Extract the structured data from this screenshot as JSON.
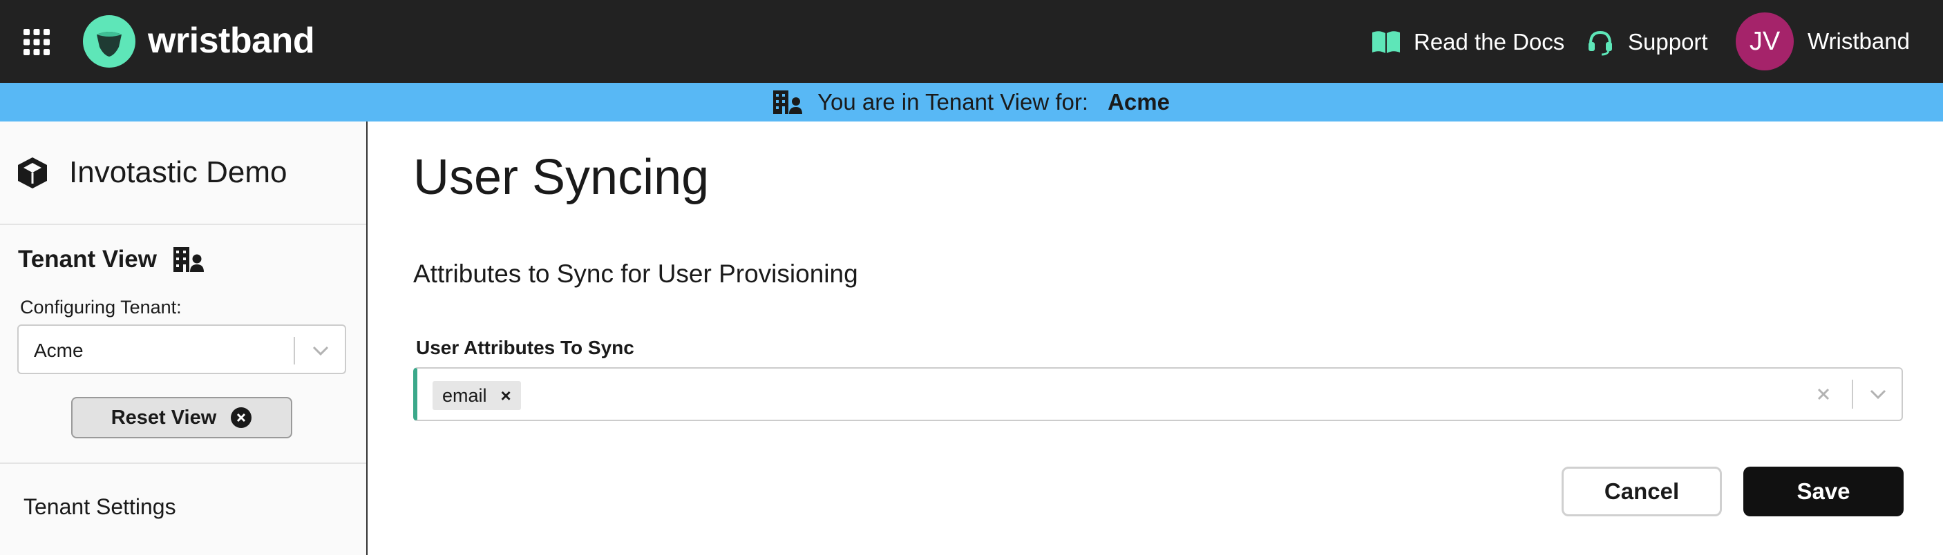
{
  "topbar": {
    "brand": "wristband",
    "docs_label": "Read the Docs",
    "support_label": "Support",
    "avatar_initials": "JV",
    "user_name": "Wristband",
    "accent_color": "#5ee6b8",
    "avatar_color": "#a5236a",
    "icons": [
      "apps-grid-icon",
      "wristband-logo-icon",
      "book-icon",
      "headset-icon"
    ]
  },
  "banner": {
    "prefix": "You are in Tenant View for:",
    "tenant": "Acme",
    "background": "#58b8f5",
    "icon": "tenant-building-icon"
  },
  "sidebar": {
    "project_name": "Invotastic Demo",
    "project_icon": "cube-icon",
    "tenant_view_title": "Tenant View",
    "configuring_label": "Configuring Tenant:",
    "selected_tenant": "Acme",
    "reset_label": "Reset View",
    "tenant_settings_label": "Tenant Settings"
  },
  "main": {
    "title": "User Syncing",
    "subtitle": "Attributes to Sync for User Provisioning",
    "field_label": "User Attributes To Sync",
    "selected_attributes": [
      "email"
    ],
    "chip_remove": "×",
    "cancel_label": "Cancel",
    "save_label": "Save",
    "field_accent": "#3ba88a"
  }
}
